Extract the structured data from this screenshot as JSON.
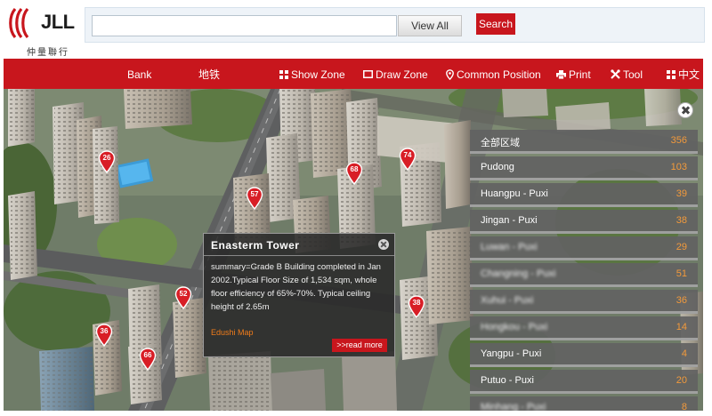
{
  "brand": {
    "logo_text": "JLL",
    "logo_chinese": "仲量聯行",
    "accent_color": "#c8161d"
  },
  "search": {
    "placeholder": "",
    "value": "",
    "view_all_label": "View All",
    "search_label": "Search"
  },
  "nav": {
    "items": [
      {
        "label": "Bank",
        "icon": ""
      },
      {
        "label": "地铁",
        "icon": ""
      },
      {
        "label": "Show Zone",
        "icon": "grid-icon"
      },
      {
        "label": "Draw Zone",
        "icon": "rectangle-icon"
      },
      {
        "label": "Common Position",
        "icon": "location-pin-icon"
      },
      {
        "label": "Print",
        "icon": "printer-icon"
      },
      {
        "label": "Tool",
        "icon": "tools-icon"
      },
      {
        "label": "中文",
        "icon": "grid-icon"
      }
    ]
  },
  "map": {
    "markers": [
      {
        "number": "26"
      },
      {
        "number": "57"
      },
      {
        "number": "68"
      },
      {
        "number": "74"
      },
      {
        "number": "38"
      },
      {
        "number": "52"
      },
      {
        "number": "36"
      },
      {
        "number": "66"
      }
    ]
  },
  "popup": {
    "title": "Enasterm  Tower",
    "body": "summary=Grade B Building completed in Jan 2002.Typical Floor Size of 1,534 sqm, whole floor efficiency of 65%-70%. Typical ceiling height of 2.65m",
    "link_label": "Edushi Map",
    "more_label": ">>read more"
  },
  "zones": [
    {
      "name": "全部区域",
      "count": "356",
      "blurred": false
    },
    {
      "name": "Pudong",
      "count": "103",
      "blurred": false
    },
    {
      "name": "Huangpu - Puxi",
      "count": "39",
      "blurred": false
    },
    {
      "name": "Jingan - Puxi",
      "count": "38",
      "blurred": false
    },
    {
      "name": "Luwan - Puxi",
      "count": "29",
      "blurred": true
    },
    {
      "name": "Changning - Puxi",
      "count": "51",
      "blurred": true
    },
    {
      "name": "Xuhui - Puxi",
      "count": "36",
      "blurred": true
    },
    {
      "name": "Hongkou - Puxi",
      "count": "14",
      "blurred": true
    },
    {
      "name": "Yangpu - Puxi",
      "count": "4",
      "blurred": false
    },
    {
      "name": "Putuo - Puxi",
      "count": "20",
      "blurred": false
    },
    {
      "name": "Minhang - Puxi",
      "count": "8",
      "blurred": true
    }
  ]
}
